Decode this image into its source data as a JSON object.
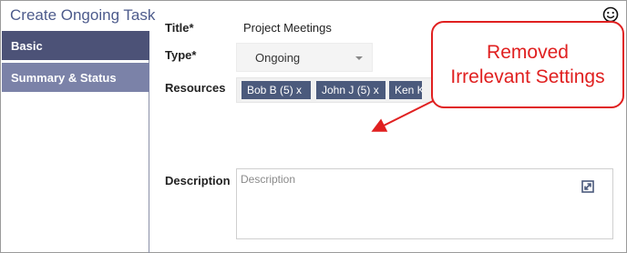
{
  "dialog": {
    "title": "Create Ongoing Task"
  },
  "sidebar": {
    "items": [
      {
        "label": "Basic",
        "active": true
      },
      {
        "label": "Summary & Status",
        "active": false
      }
    ]
  },
  "form": {
    "title_label": "Title*",
    "title_value": "Project Meetings",
    "type_label": "Type*",
    "type_value": "Ongoing",
    "resources_label": "Resources",
    "resources": [
      "Bob B (5) x",
      "John J (5) x",
      "Ken K ("
    ],
    "description_label": "Description",
    "description_placeholder": "Description"
  },
  "callout": {
    "line1": "Removed",
    "line2": "Irrelevant Settings",
    "color": "#e02020"
  },
  "colors": {
    "nav_active": "#4c5277",
    "nav_inactive": "#7b82a8",
    "chip": "#4b5a7c",
    "title_text": "#4d5b8c"
  },
  "icons": {
    "top_right": "smiley-icon",
    "description": "expand-icon",
    "type_select": "chevron-down-icon"
  }
}
